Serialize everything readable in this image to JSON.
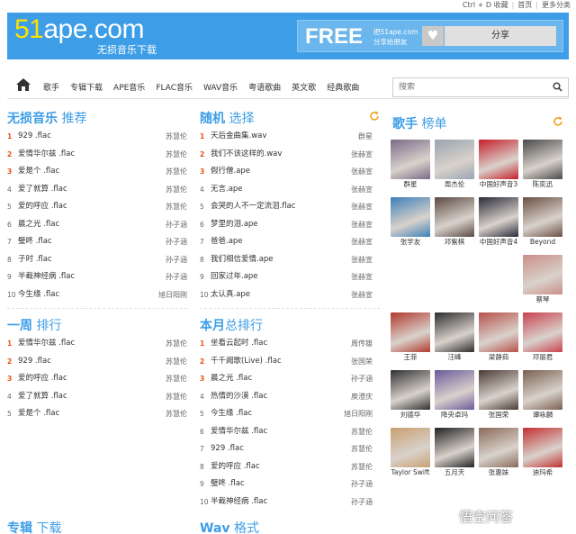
{
  "topbar": {
    "bookmark": "Ctrl + D 收藏",
    "home": "首页",
    "more": "更多分类"
  },
  "header": {
    "logo_num": "51",
    "logo_rest": "ape.com",
    "slogan": "无损音乐下载",
    "free": "FREE",
    "free_sub1": "把51ape.com",
    "free_sub2": "分享给朋友",
    "share": "分享"
  },
  "nav": {
    "items": [
      "歌手",
      "专辑下载",
      "APE音乐",
      "FLAC音乐",
      "WAV音乐",
      "粤语歌曲",
      "英文歌",
      "经典歌曲"
    ],
    "search_placeholder": "搜索"
  },
  "lossless": {
    "title_bold": "无损音乐",
    "title_rest": "推荐",
    "items": [
      {
        "n": "1",
        "t": "929 .flac",
        "a": "苏慧伦"
      },
      {
        "n": "2",
        "t": "爱情华尔兹 .flac",
        "a": "苏慧伦"
      },
      {
        "n": "3",
        "t": "爱是个 .flac",
        "a": "苏慧伦"
      },
      {
        "n": "4",
        "t": "爱了就算 .flac",
        "a": "苏慧伦"
      },
      {
        "n": "5",
        "t": "爱的呼应 .flac",
        "a": "苏慧伦"
      },
      {
        "n": "6",
        "t": "晨之光 .flac",
        "a": "孙子涵"
      },
      {
        "n": "7",
        "t": "璧咚 .flac",
        "a": "孙子涵"
      },
      {
        "n": "8",
        "t": "子时 .flac",
        "a": "孙子涵"
      },
      {
        "n": "9",
        "t": "半截神经病 .flac",
        "a": "孙子涵"
      },
      {
        "n": "10",
        "t": "今生缘 .flac",
        "a": "旭日阳刚"
      }
    ]
  },
  "random": {
    "title_bold": "随机",
    "title_rest": "选择",
    "items": [
      {
        "n": "1",
        "t": "天后金曲集.wav",
        "a": "群星"
      },
      {
        "n": "2",
        "t": "我们不该这样的.wav",
        "a": "张赫宣"
      },
      {
        "n": "3",
        "t": "假行僧.ape",
        "a": "张赫宣"
      },
      {
        "n": "4",
        "t": "无言.ape",
        "a": "张赫宣"
      },
      {
        "n": "5",
        "t": "会哭的人不一定流泪.flac",
        "a": "张赫宣"
      },
      {
        "n": "6",
        "t": "梦里的泪.ape",
        "a": "张赫宣"
      },
      {
        "n": "7",
        "t": "爸爸.ape",
        "a": "张赫宣"
      },
      {
        "n": "8",
        "t": "我们相信爱情.ape",
        "a": "张赫宣"
      },
      {
        "n": "9",
        "t": "回家过年.ape",
        "a": "张赫宣"
      },
      {
        "n": "10",
        "t": "太认真.ape",
        "a": "张赫宣"
      }
    ]
  },
  "week": {
    "title_bold": "一周",
    "title_rest": "排行",
    "items": [
      {
        "n": "1",
        "t": "爱情华尔兹 .flac",
        "a": "苏慧伦"
      },
      {
        "n": "2",
        "t": "929 .flac",
        "a": "苏慧伦"
      },
      {
        "n": "3",
        "t": "爱的呼应 .flac",
        "a": "苏慧伦"
      },
      {
        "n": "4",
        "t": "爱了就算 .flac",
        "a": "苏慧伦"
      },
      {
        "n": "5",
        "t": "爱是个 .flac",
        "a": "苏慧伦"
      }
    ]
  },
  "month": {
    "title_bold": "本月",
    "title_rest": "总排行",
    "items": [
      {
        "n": "1",
        "t": "坐看云起时 .flac",
        "a": "周传雄"
      },
      {
        "n": "2",
        "t": "千千阙歌(Live) .flac",
        "a": "张国荣"
      },
      {
        "n": "3",
        "t": "晨之光 .flac",
        "a": "孙子涵"
      },
      {
        "n": "4",
        "t": "热情的沙漠 .flac",
        "a": "庾澄庆"
      },
      {
        "n": "5",
        "t": "今生缘 .flac",
        "a": "旭日阳刚"
      },
      {
        "n": "6",
        "t": "爱情华尔兹 .flac",
        "a": "苏慧伦"
      },
      {
        "n": "7",
        "t": "929 .flac",
        "a": "苏慧伦"
      },
      {
        "n": "8",
        "t": "爱的呼应 .flac",
        "a": "苏慧伦"
      },
      {
        "n": "9",
        "t": "璧咚 .flac",
        "a": "孙子涵"
      },
      {
        "n": "10",
        "t": "半截神经病 .flac",
        "a": "孙子涵"
      }
    ]
  },
  "album": {
    "title_bold": "专辑",
    "title_rest": "下载"
  },
  "wav": {
    "title_bold": "Wav",
    "title_rest": "格式"
  },
  "singers": {
    "title_bold": "歌手",
    "title_rest": "榜单",
    "items": [
      {
        "name": "群星",
        "color": "#7a6a88"
      },
      {
        "name": "周杰伦",
        "color": "#9aa4b0"
      },
      {
        "name": "中国好声音3",
        "color": "#c41f2a"
      },
      {
        "name": "陈奕迅",
        "color": "#4a4a4a"
      },
      {
        "name": "张学友",
        "color": "#3d7fb8"
      },
      {
        "name": "邓紫棋",
        "color": "#5a4a42"
      },
      {
        "name": "中国好声音4",
        "color": "#2a2a38"
      },
      {
        "name": "Beyond",
        "color": "#6a5044"
      },
      {
        "name": "蔡琴",
        "color": "#c98f86"
      },
      {
        "name": "王菲",
        "color": "#b03a2e"
      },
      {
        "name": "汪峰",
        "color": "#2d2d2d"
      },
      {
        "name": "梁静茹",
        "color": "#b8504a"
      },
      {
        "name": "邓丽君",
        "color": "#c9424f"
      },
      {
        "name": "刘德华",
        "color": "#303030"
      },
      {
        "name": "降央卓玛",
        "color": "#6b5a9a"
      },
      {
        "name": "张国荣",
        "color": "#4a3a34"
      },
      {
        "name": "谭咏麟",
        "color": "#7a6050"
      },
      {
        "name": "Taylor Swift",
        "color": "#c8a070"
      },
      {
        "name": "五月天",
        "color": "#222222"
      },
      {
        "name": "张惠妹",
        "color": "#8a6a5a"
      },
      {
        "name": "迪玛希",
        "color": "#c23030"
      }
    ]
  },
  "watermark": "悟空问答"
}
